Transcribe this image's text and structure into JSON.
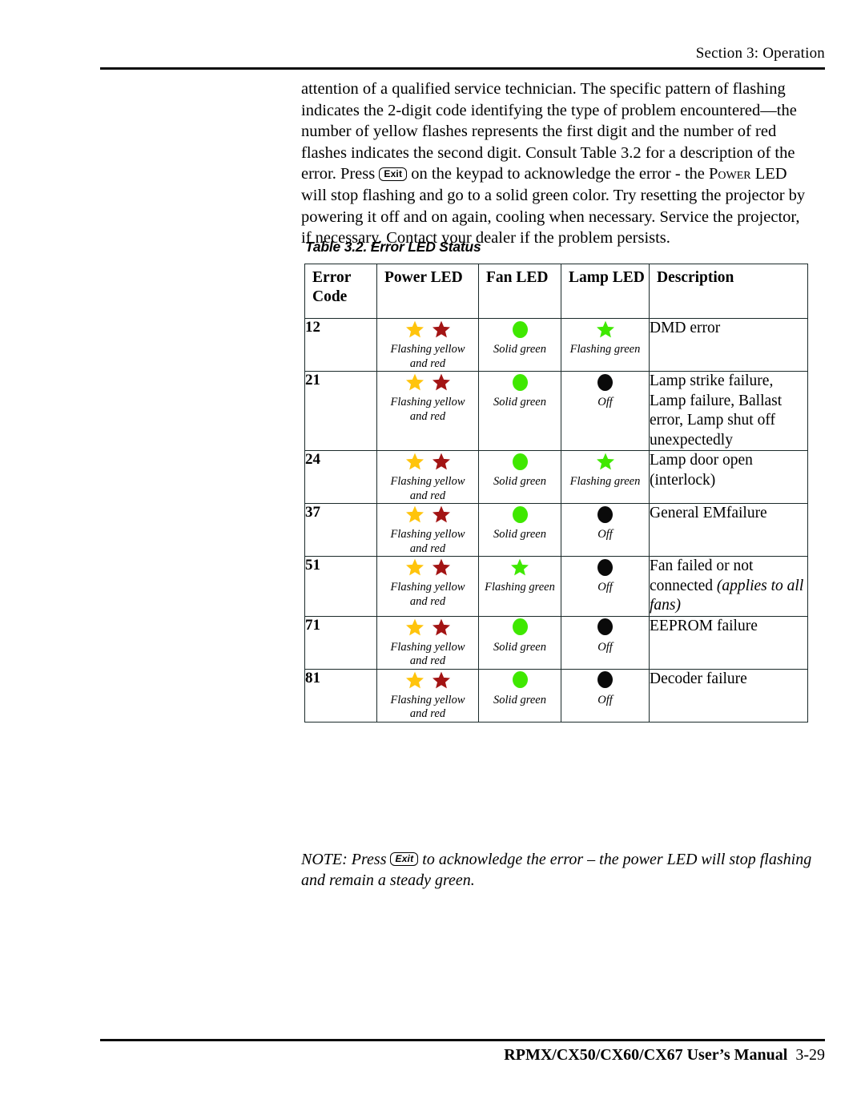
{
  "header": {
    "section_label": "Section 3: Operation"
  },
  "body": {
    "paragraph_part1": "attention of a qualified service technician. The specific pattern of flashing indicates the 2-digit code identifying the type of problem encountered—the number of yellow flashes represents the first digit and the number of red flashes indicates the second digit. Consult Table 3.2 for a description of the error. Press",
    "exit_key_label": "Exit",
    "paragraph_part2": " on the keypad to acknowledge the error - the ",
    "power_smallcaps": "Power",
    "paragraph_part3": " LED will stop flashing and go to a solid green color. Try resetting the projector by powering it off and on again, cooling when necessary. Service the projector, if necessary. Contact your dealer if the problem persists."
  },
  "table": {
    "caption": "Table 3.2. Error LED Status",
    "columns": [
      "Error Code",
      "Power LED",
      "Fan LED",
      "Lamp LED",
      "Description"
    ],
    "colors": {
      "yellow": "#FFC40C",
      "red": "#A31414",
      "green": "#3FE800",
      "off": "#0A0A0A"
    },
    "rows": [
      {
        "code": "12",
        "power": {
          "icons": [
            "star-yellow",
            "star-red"
          ],
          "caption": "Flashing yellow and red"
        },
        "fan": {
          "icons": [
            "dot-green"
          ],
          "caption": "Solid green"
        },
        "lamp": {
          "icons": [
            "star-green"
          ],
          "caption": "Flashing green"
        },
        "description": "DMD error"
      },
      {
        "code": "21",
        "power": {
          "icons": [
            "star-yellow",
            "star-red"
          ],
          "caption": "Flashing yellow and red"
        },
        "fan": {
          "icons": [
            "dot-green"
          ],
          "caption": "Solid green"
        },
        "lamp": {
          "icons": [
            "dot-off"
          ],
          "caption": "Off"
        },
        "description": "Lamp strike failure, Lamp failure, Ballast error, Lamp shut off unexpectedly"
      },
      {
        "code": "24",
        "power": {
          "icons": [
            "star-yellow",
            "star-red"
          ],
          "caption": "Flashing yellow and red"
        },
        "fan": {
          "icons": [
            "dot-green"
          ],
          "caption": "Solid green"
        },
        "lamp": {
          "icons": [
            "star-green"
          ],
          "caption": "Flashing green"
        },
        "description": "Lamp door open (interlock)"
      },
      {
        "code": "37",
        "power": {
          "icons": [
            "star-yellow",
            "star-red"
          ],
          "caption": "Flashing yellow and red"
        },
        "fan": {
          "icons": [
            "dot-green"
          ],
          "caption": "Solid green"
        },
        "lamp": {
          "icons": [
            "dot-off"
          ],
          "caption": "Off"
        },
        "description": "General EMfailure"
      },
      {
        "code": "51",
        "power": {
          "icons": [
            "star-yellow",
            "star-red"
          ],
          "caption": "Flashing yellow and red"
        },
        "fan": {
          "icons": [
            "star-green"
          ],
          "caption": "Flashing green"
        },
        "lamp": {
          "icons": [
            "dot-off"
          ],
          "caption": "Off"
        },
        "description": "Fan failed or not connected (applies to all fans)",
        "description_plain": "Fan failed or not connected ",
        "description_italic": "(applies to all fans)"
      },
      {
        "code": "71",
        "power": {
          "icons": [
            "star-yellow",
            "star-red"
          ],
          "caption": "Flashing yellow and red"
        },
        "fan": {
          "icons": [
            "dot-green"
          ],
          "caption": "Solid green"
        },
        "lamp": {
          "icons": [
            "dot-off"
          ],
          "caption": "Off"
        },
        "description": "EEPROM failure"
      },
      {
        "code": "81",
        "power": {
          "icons": [
            "star-yellow",
            "star-red"
          ],
          "caption": "Flashing yellow and red"
        },
        "fan": {
          "icons": [
            "dot-green"
          ],
          "caption": "Solid green"
        },
        "lamp": {
          "icons": [
            "dot-off"
          ],
          "caption": "Off"
        },
        "description": "Decoder failure"
      }
    ]
  },
  "note": {
    "part1": "NOTE: Press ",
    "exit_key_label": "Exit",
    "part2": " to acknowledge the error – the power LED will stop flashing and remain a steady green."
  },
  "footer": {
    "manual": "RPMX/CX50/CX60/CX67 User’s Manual",
    "page_number": "3-29"
  }
}
